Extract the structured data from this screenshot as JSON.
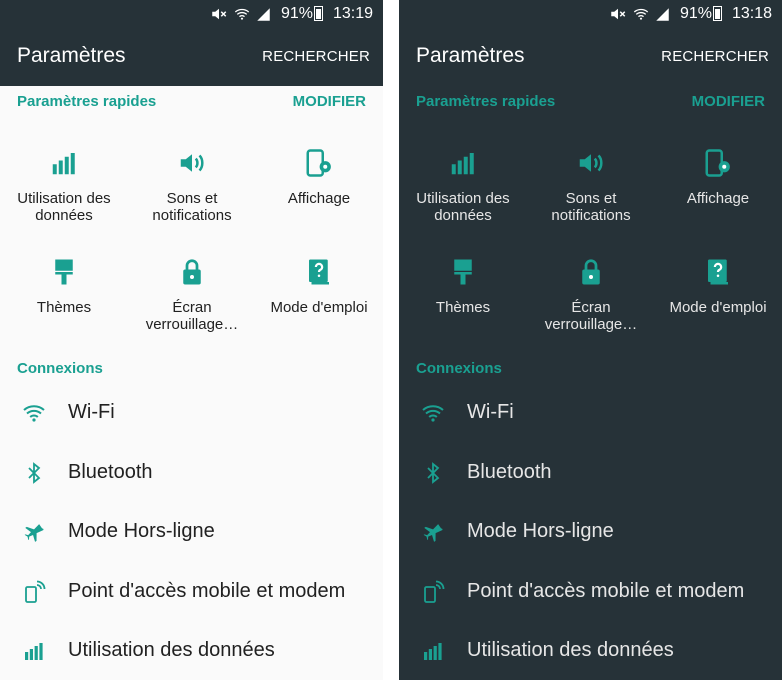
{
  "panels": [
    {
      "theme": "light",
      "status": {
        "battery": "91%",
        "time": "13:19"
      },
      "toolbar": {
        "title": "Paramètres",
        "search": "RECHERCHER"
      },
      "quick": {
        "header": "Paramètres rapides",
        "edit": "MODIFIER",
        "items": [
          {
            "label": "Utilisation des données",
            "icon": "data-usage-icon"
          },
          {
            "label": "Sons et notifications",
            "icon": "volume-icon"
          },
          {
            "label": "Affichage",
            "icon": "display-settings-icon"
          },
          {
            "label": "Thèmes",
            "icon": "paint-brush-icon"
          },
          {
            "label": "Écran verrouillage…",
            "icon": "lock-icon"
          },
          {
            "label": "Mode d'emploi",
            "icon": "help-book-icon"
          }
        ]
      },
      "connections": {
        "header": "Connexions",
        "items": [
          {
            "label": "Wi-Fi",
            "icon": "wifi-icon"
          },
          {
            "label": "Bluetooth",
            "icon": "bluetooth-icon"
          },
          {
            "label": "Mode Hors-ligne",
            "icon": "airplane-icon"
          },
          {
            "label": "Point d'accès mobile et modem",
            "icon": "hotspot-icon"
          },
          {
            "label": "Utilisation des données",
            "icon": "data-usage-icon"
          }
        ]
      }
    },
    {
      "theme": "dark",
      "status": {
        "battery": "91%",
        "time": "13:18"
      },
      "toolbar": {
        "title": "Paramètres",
        "search": "RECHERCHER"
      },
      "quick": {
        "header": "Paramètres rapides",
        "edit": "MODIFIER",
        "items": [
          {
            "label": "Utilisation des données",
            "icon": "data-usage-icon"
          },
          {
            "label": "Sons et notifications",
            "icon": "volume-icon"
          },
          {
            "label": "Affichage",
            "icon": "display-settings-icon"
          },
          {
            "label": "Thèmes",
            "icon": "paint-brush-icon"
          },
          {
            "label": "Écran verrouillage…",
            "icon": "lock-icon"
          },
          {
            "label": "Mode d'emploi",
            "icon": "help-book-icon"
          }
        ]
      },
      "connections": {
        "header": "Connexions",
        "items": [
          {
            "label": "Wi-Fi",
            "icon": "wifi-icon"
          },
          {
            "label": "Bluetooth",
            "icon": "bluetooth-icon"
          },
          {
            "label": "Mode Hors-ligne",
            "icon": "airplane-icon"
          },
          {
            "label": "Point d'accès mobile et modem",
            "icon": "hotspot-icon"
          },
          {
            "label": "Utilisation des données",
            "icon": "data-usage-icon"
          }
        ]
      }
    }
  ],
  "colors": {
    "accent": "#1aa091",
    "bar": "#263238",
    "light_bg": "#fafafa",
    "dark_bg": "#263238"
  }
}
